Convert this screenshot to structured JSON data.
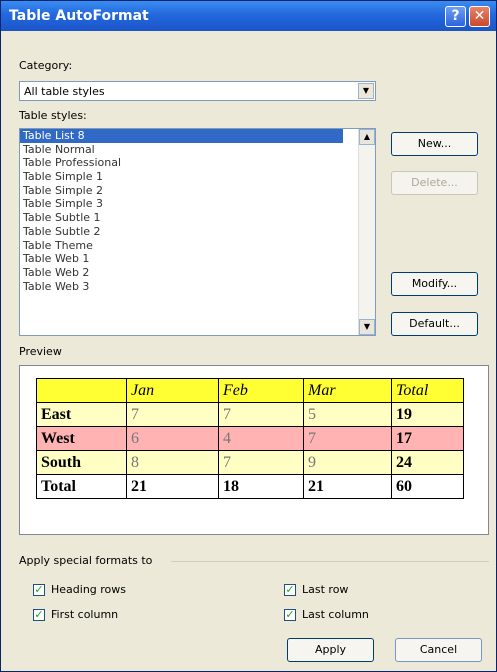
{
  "dialog": {
    "title": "Table AutoFormat",
    "help_glyph": "?",
    "close_glyph": "✕"
  },
  "category": {
    "label": "Category:",
    "value": "All table styles"
  },
  "table_styles": {
    "label": "Table styles:",
    "items": [
      "Table List 8",
      "Table Normal",
      "Table Professional",
      "Table Simple 1",
      "Table Simple 2",
      "Table Simple 3",
      "Table Subtle 1",
      "Table Subtle 2",
      "Table Theme",
      "Table Web 1",
      "Table Web 2",
      "Table Web 3"
    ],
    "selected": "Table List 8"
  },
  "buttons": {
    "new": "New...",
    "delete": "Delete...",
    "modify": "Modify...",
    "default": "Default...",
    "apply": "Apply",
    "cancel": "Cancel"
  },
  "preview": {
    "label": "Preview",
    "header": [
      "",
      "Jan",
      "Feb",
      "Mar",
      "Total"
    ],
    "rows": [
      [
        "East",
        "7",
        "7",
        "5",
        "19"
      ],
      [
        "West",
        "6",
        "4",
        "7",
        "17"
      ],
      [
        "South",
        "8",
        "7",
        "9",
        "24"
      ],
      [
        "Total",
        "21",
        "18",
        "21",
        "60"
      ]
    ],
    "colors": {
      "header": "#ffff33",
      "light_row": "#ffffc4",
      "pink_row": "#ffb3b3"
    }
  },
  "special_formats": {
    "label": "Apply special formats to",
    "options": [
      {
        "label": "Heading rows",
        "checked": true
      },
      {
        "label": "First column",
        "checked": true
      },
      {
        "label": "Last row",
        "checked": true
      },
      {
        "label": "Last column",
        "checked": true
      }
    ]
  },
  "icons": {
    "dropdown": "chevron-down-icon",
    "scroll_up": "arrow-up-icon",
    "scroll_down": "arrow-down-icon",
    "check": "checkmark-icon"
  },
  "glyphs": {
    "down": "▼",
    "up": "▲",
    "check": "✓"
  }
}
